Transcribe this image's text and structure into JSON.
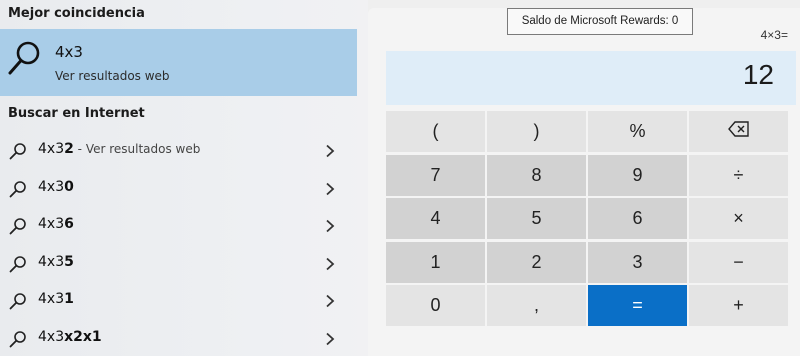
{
  "search": {
    "best_match_heading": "Mejor coincidencia",
    "best_match": {
      "title": "4x3",
      "subtitle": "Ver resultados web",
      "icon": "search-icon"
    },
    "web_heading": "Buscar en Internet",
    "web_results": [
      {
        "prefix": "4x3",
        "bold": "2",
        "suffix": " - Ver resultados web"
      },
      {
        "prefix": "4x3",
        "bold": "0",
        "suffix": ""
      },
      {
        "prefix": "4x3",
        "bold": "6",
        "suffix": ""
      },
      {
        "prefix": "4x3",
        "bold": "5",
        "suffix": ""
      },
      {
        "prefix": "4x3",
        "bold": "1",
        "suffix": ""
      },
      {
        "prefix": "4x3",
        "bold": "x2x1",
        "suffix": ""
      }
    ]
  },
  "calculator": {
    "tooltip": "Saldo de Microsoft Rewards: 0",
    "expression": "4×3=",
    "result": "12",
    "keys": [
      [
        "(",
        ")",
        "%",
        "⌫"
      ],
      [
        "7",
        "8",
        "9",
        "÷"
      ],
      [
        "4",
        "5",
        "6",
        "×"
      ],
      [
        "1",
        "2",
        "3",
        "−"
      ],
      [
        "0",
        ",",
        "=",
        "+"
      ]
    ],
    "accent_color": "#0a6fc7"
  }
}
